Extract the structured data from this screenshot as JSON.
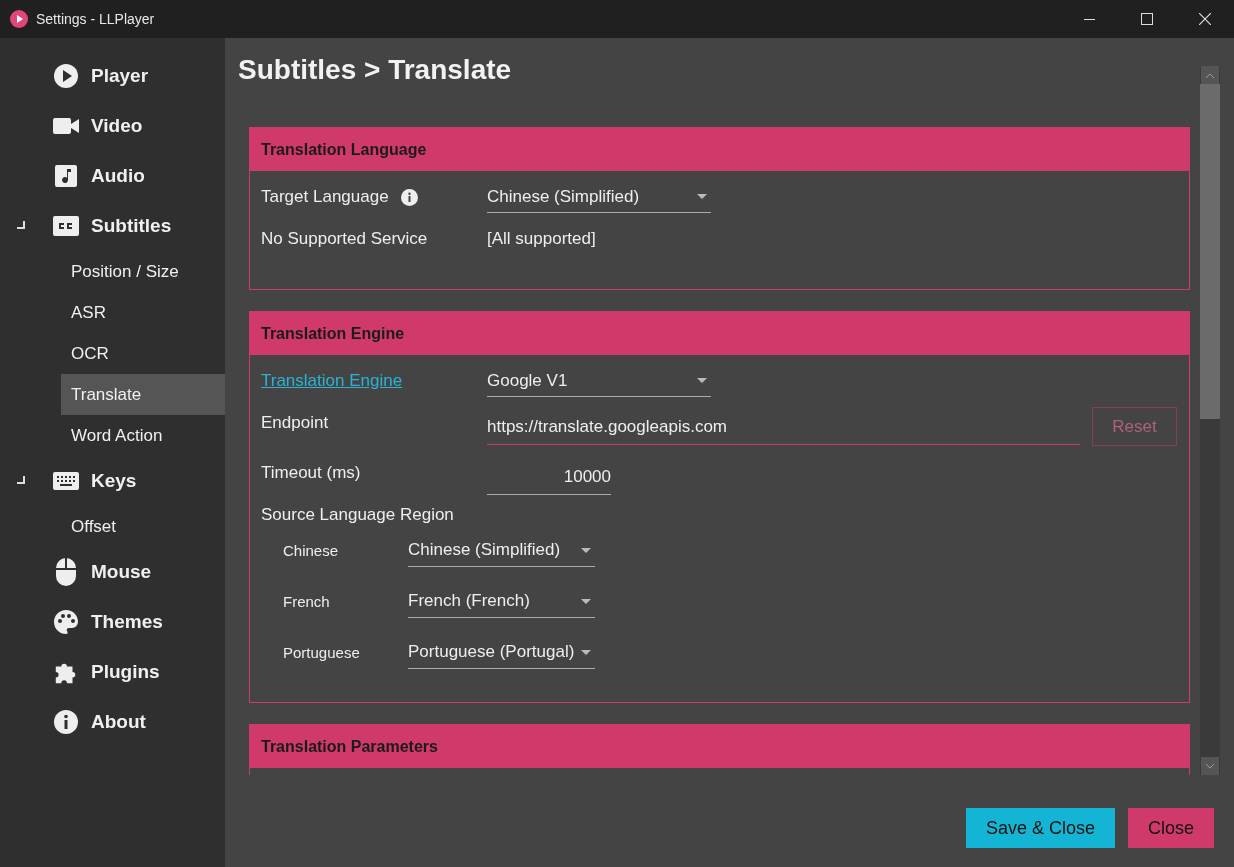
{
  "window": {
    "title": "Settings - LLPlayer"
  },
  "sidebar": {
    "items": [
      {
        "label": "Player",
        "selected": false
      },
      {
        "label": "Video",
        "selected": false
      },
      {
        "label": "Audio",
        "selected": false
      },
      {
        "label": "Subtitles",
        "selected": false,
        "expanded": true,
        "children": [
          {
            "label": "Position / Size",
            "selected": false
          },
          {
            "label": "ASR",
            "selected": false
          },
          {
            "label": "OCR",
            "selected": false
          },
          {
            "label": "Translate",
            "selected": true
          },
          {
            "label": "Word Action",
            "selected": false
          }
        ]
      },
      {
        "label": "Keys",
        "selected": false,
        "expanded": true,
        "children": [
          {
            "label": "Offset",
            "selected": false
          }
        ]
      },
      {
        "label": "Mouse",
        "selected": false
      },
      {
        "label": "Themes",
        "selected": false
      },
      {
        "label": "Plugins",
        "selected": false
      },
      {
        "label": "About",
        "selected": false
      }
    ]
  },
  "page_title": "Subtitles > Translate",
  "sections": [
    {
      "title": "Translation Language",
      "rows": [
        {
          "kind": "dropdown",
          "label": "Target Language",
          "info": true,
          "value": "Chinese (Simplified)"
        },
        {
          "kind": "text",
          "label": "No Supported Service",
          "value": "[All supported]"
        }
      ]
    },
    {
      "title": "Translation Engine",
      "rows": [
        {
          "kind": "dropdown",
          "label": "Translation Engine",
          "link": true,
          "value": "Google V1"
        },
        {
          "kind": "input",
          "label": "Endpoint",
          "value": "https://translate.googleapis.com",
          "wide": true,
          "button": {
            "label": "Reset",
            "disabled": true
          }
        },
        {
          "kind": "input",
          "label": "Timeout (ms)",
          "value": "10000"
        },
        {
          "kind": "region",
          "label": "Source Language Region",
          "items": [
            {
              "label": "Chinese",
              "value": "Chinese (Simplified)"
            },
            {
              "label": "French",
              "value": "French (French)"
            },
            {
              "label": "Portuguese",
              "value": "Portuguese (Portugal)"
            }
          ]
        }
      ]
    },
    {
      "title": "Translation Parameters"
    }
  ],
  "buttons": [
    {
      "label": "Save & Close",
      "kind": "primary"
    },
    {
      "label": "Close",
      "kind": "secondary"
    }
  ]
}
